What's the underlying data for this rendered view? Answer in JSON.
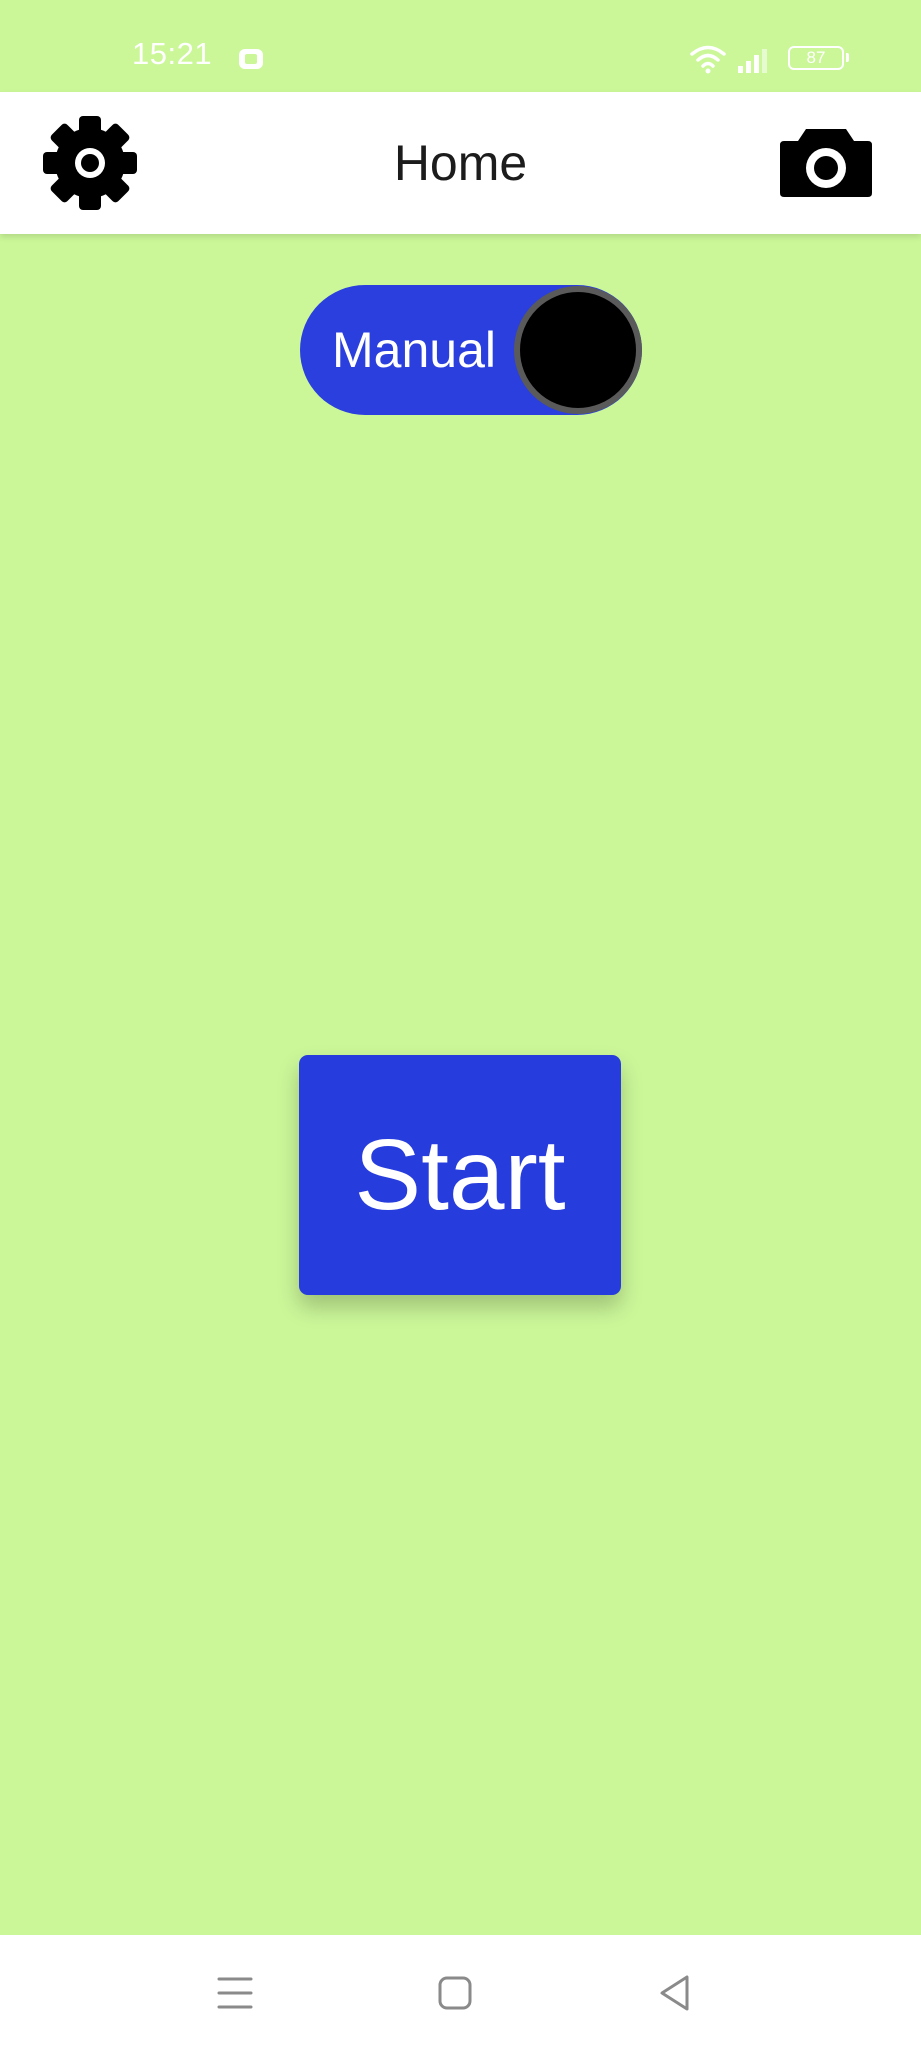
{
  "status_bar": {
    "time": "15:21",
    "battery_level": "87",
    "icons": [
      "notification-icon",
      "wifi-icon",
      "signal-icon",
      "battery-icon"
    ]
  },
  "app_bar": {
    "title": "Home",
    "left_icon": "gear-icon",
    "right_icon": "camera-icon"
  },
  "mode_toggle": {
    "label": "Manual"
  },
  "start_button": {
    "label": "Start"
  },
  "nav_bar": {
    "icons": [
      "menu-icon",
      "home-icon",
      "back-icon"
    ]
  },
  "colors": {
    "background": "#cbf799",
    "accent_blue": "#273cdc",
    "app_bar": "#ffffff",
    "title_text": "#1c1c1c",
    "knob": "#000000"
  }
}
